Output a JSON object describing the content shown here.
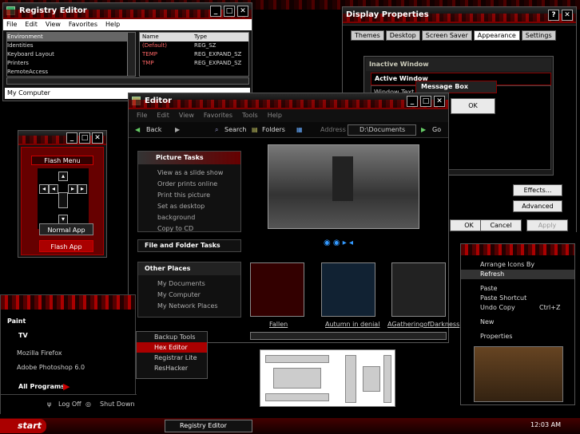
{
  "regedit": {
    "title": "Registry Editor",
    "menu": [
      "File",
      "Edit",
      "View",
      "Favorites",
      "Help"
    ],
    "tree": [
      "Environment",
      "Identities",
      "Keyboard Layout",
      "Printers",
      "RemoteAccess"
    ],
    "cols": [
      "Name",
      "Type"
    ],
    "rows": [
      {
        "name": "(Default)",
        "type": "REG_SZ"
      },
      {
        "name": "TEMP",
        "type": "REG_EXPAND_SZ"
      },
      {
        "name": "TMP",
        "type": "REG_EXPAND_SZ"
      }
    ],
    "status": "My Computer"
  },
  "display": {
    "title": "Display Properties",
    "tabs": [
      "Themes",
      "Desktop",
      "Screen Saver",
      "Appearance",
      "Settings"
    ],
    "inactive": "Inactive Window",
    "active": "Active Window",
    "window_text": "Window Text",
    "msgbox": "Message Box",
    "ok": "OK",
    "effects": "Effects...",
    "advanced": "Advanced",
    "ok2": "OK",
    "cancel": "Cancel",
    "apply": "Apply"
  },
  "flash": {
    "title": "Flash Menu",
    "normal": "Normal App",
    "flashapp": "Flash App"
  },
  "editor": {
    "title": "Editor",
    "menu": [
      "File",
      "Edit",
      "View",
      "Favorites",
      "Tools",
      "Help"
    ],
    "back": "Back",
    "search": "Search",
    "folders": "Folders",
    "address_label": "Address",
    "address": "D:\\Documents",
    "go": "Go",
    "picture_tasks": "Picture Tasks",
    "tasks": [
      "View as a slide show",
      "Order prints online",
      "Print this picture",
      "Set as desktop background",
      "Copy to CD"
    ],
    "file_folder": "File and Folder Tasks",
    "other_places": "Other Places",
    "places": [
      "My Documents",
      "My Computer",
      "My Network Places"
    ],
    "thumbs": [
      "Fallen",
      "Autumn in denial",
      "AGatheringofDarkness"
    ]
  },
  "start_menu": {
    "items": [
      "Paint",
      "TV",
      "Mozilla Firefox",
      "Adobe Photoshop 6.0"
    ],
    "all_programs": "All Programs",
    "logoff": "Log Off",
    "shutdown": "Shut Down",
    "sub": [
      "Backup Tools",
      "Hex Editor",
      "Registrar Lite",
      "ResHacker"
    ]
  },
  "context": {
    "items": [
      "Arrange Icons By",
      "Refresh",
      "Paste",
      "Paste Shortcut",
      "Undo Copy",
      "New",
      "Properties"
    ],
    "shortcut": "Ctrl+Z"
  },
  "taskbar": {
    "start": "start",
    "task": "Registry Editor",
    "clock": "12:03 AM"
  },
  "colors": {
    "accent": "#b00000",
    "dark": "#000000"
  }
}
